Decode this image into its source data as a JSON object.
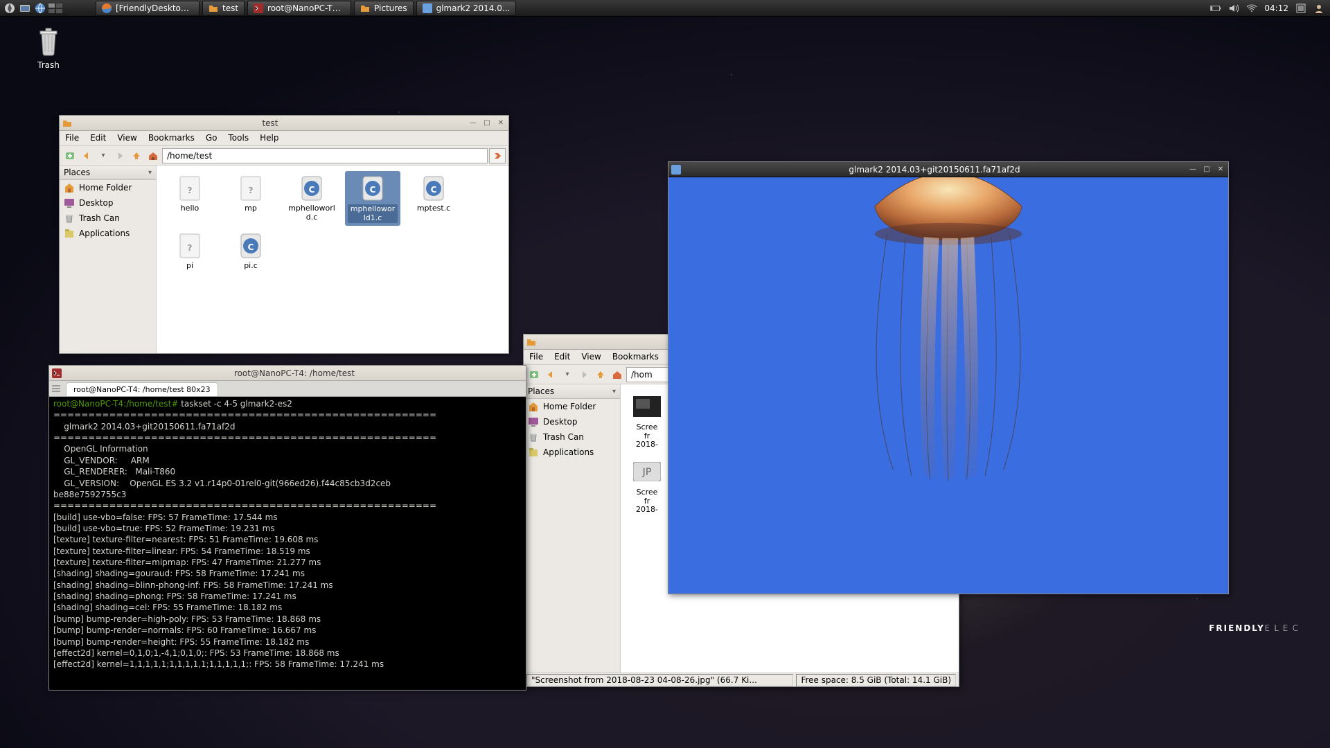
{
  "panel": {
    "tasks": [
      {
        "label": "[FriendlyDesktop...",
        "icon": "firefox"
      },
      {
        "label": "test",
        "icon": "folder"
      },
      {
        "label": "root@NanoPC-T4...",
        "icon": "terminal"
      },
      {
        "label": "Pictures",
        "icon": "folder"
      },
      {
        "label": "glmark2 2014.0...",
        "icon": "app"
      }
    ],
    "clock": "04:12"
  },
  "desktop": {
    "trash_label": "Trash"
  },
  "brand": {
    "a": "FRIENDLY",
    "b": "ELEC"
  },
  "win_test": {
    "title": "test",
    "menus": [
      "File",
      "Edit",
      "View",
      "Bookmarks",
      "Go",
      "Tools",
      "Help"
    ],
    "path": "/home/test",
    "places_header": "Places",
    "places": [
      {
        "label": "Home Folder",
        "icon": "home"
      },
      {
        "label": "Desktop",
        "icon": "desktop"
      },
      {
        "label": "Trash Can",
        "icon": "trash"
      },
      {
        "label": "Applications",
        "icon": "apps"
      }
    ],
    "files": [
      {
        "label": "hello",
        "type": "unknown"
      },
      {
        "label": "mp",
        "type": "unknown"
      },
      {
        "label": "mphelloworld.c",
        "type": "c"
      },
      {
        "label": "mphelloworld1.c",
        "type": "c",
        "selected": true
      },
      {
        "label": "mptest.c",
        "type": "c"
      },
      {
        "label": "pi",
        "type": "unknown"
      },
      {
        "label": "pi.c",
        "type": "c"
      }
    ]
  },
  "win_pics": {
    "menus": [
      "File",
      "Edit",
      "View",
      "Bookmarks"
    ],
    "path": "/hom",
    "places_header": "Places",
    "places": [
      {
        "label": "Home Folder",
        "icon": "home"
      },
      {
        "label": "Desktop",
        "icon": "desktop"
      },
      {
        "label": "Trash Can",
        "icon": "trash"
      },
      {
        "label": "Applications",
        "icon": "apps"
      }
    ],
    "thumbs": [
      {
        "line1": "Scree",
        "line2": "fr",
        "line3": "2018-"
      },
      {
        "line1": "Scree",
        "line2": "fr",
        "line3": "2018-"
      }
    ],
    "status_left": "\"Screenshot from 2018-08-23 04-08-26.jpg\" (66.7 Ki...",
    "status_right": "Free space: 8.5 GiB (Total: 14.1 GiB)"
  },
  "win_term": {
    "title": "root@NanoPC-T4: /home/test",
    "tab": "root@NanoPC-T4: /home/test 80x23",
    "prompt": "root@NanoPC-T4:/home/test#",
    "command": " taskset -c 4-5 glmark2-es2",
    "lines": [
      "=======================================================",
      "    glmark2 2014.03+git20150611.fa71af2d",
      "=======================================================",
      "    OpenGL Information",
      "    GL_VENDOR:     ARM",
      "    GL_RENDERER:   Mali-T860",
      "    GL_VERSION:    OpenGL ES 3.2 v1.r14p0-01rel0-git(966ed26).f44c85cb3d2ceb",
      "be88e7592755c3",
      "=======================================================",
      "[build] use-vbo=false: FPS: 57 FrameTime: 17.544 ms",
      "[build] use-vbo=true: FPS: 52 FrameTime: 19.231 ms",
      "[texture] texture-filter=nearest: FPS: 51 FrameTime: 19.608 ms",
      "[texture] texture-filter=linear: FPS: 54 FrameTime: 18.519 ms",
      "[texture] texture-filter=mipmap: FPS: 47 FrameTime: 21.277 ms",
      "[shading] shading=gouraud: FPS: 58 FrameTime: 17.241 ms",
      "[shading] shading=blinn-phong-inf: FPS: 58 FrameTime: 17.241 ms",
      "[shading] shading=phong: FPS: 58 FrameTime: 17.241 ms",
      "[shading] shading=cel: FPS: 55 FrameTime: 18.182 ms",
      "[bump] bump-render=high-poly: FPS: 53 FrameTime: 18.868 ms",
      "[bump] bump-render=normals: FPS: 60 FrameTime: 16.667 ms",
      "[bump] bump-render=height: FPS: 55 FrameTime: 18.182 ms",
      "[effect2d] kernel=0,1,0;1,-4,1;0,1,0;: FPS: 53 FrameTime: 18.868 ms",
      "[effect2d] kernel=1,1,1,1,1;1,1,1,1,1;1,1,1,1,1;: FPS: 58 FrameTime: 17.241 ms"
    ]
  },
  "win_gl": {
    "title": "glmark2 2014.03+git20150611.fa71af2d"
  }
}
